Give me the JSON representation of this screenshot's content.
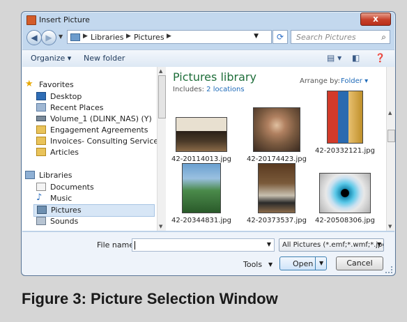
{
  "window": {
    "title": "Insert Picture",
    "close_glyph": "x"
  },
  "address": {
    "crumbs": [
      "Libraries",
      "Pictures"
    ],
    "search_placeholder": "Search Pictures"
  },
  "toolbar": {
    "organize": "Organize ▾",
    "new_folder": "New folder"
  },
  "nav": {
    "favorites_header": "Favorites",
    "favorites": [
      "Desktop",
      "Recent Places",
      "Volume_1 (DLINK_NAS) (Y)",
      "Engagement Agreements",
      "Invoices- Consulting Services",
      "Articles"
    ],
    "libraries_header": "Libraries",
    "libraries": [
      "Documents",
      "Music",
      "Pictures",
      "Sounds"
    ],
    "selected": "Pictures"
  },
  "content": {
    "title": "Pictures library",
    "includes_label": "Includes:",
    "includes_link": "2 locations",
    "arrange_label": "Arrange by:",
    "arrange_value": "Folder ▾",
    "files": [
      "42-20114013.jpg",
      "42-20174423.jpg",
      "42-20332121.jpg",
      "42-20344831.jpg",
      "42-20373537.jpg",
      "42-20508306.jpg"
    ]
  },
  "footer": {
    "file_name_label": "File name:",
    "file_name_value": "",
    "filter": "All Pictures (*.emf;*.wmf;*.jpg;*",
    "tools": "Tools",
    "open": "Open",
    "cancel": "Cancel"
  },
  "caption": "Figure 3: Picture Selection Window"
}
